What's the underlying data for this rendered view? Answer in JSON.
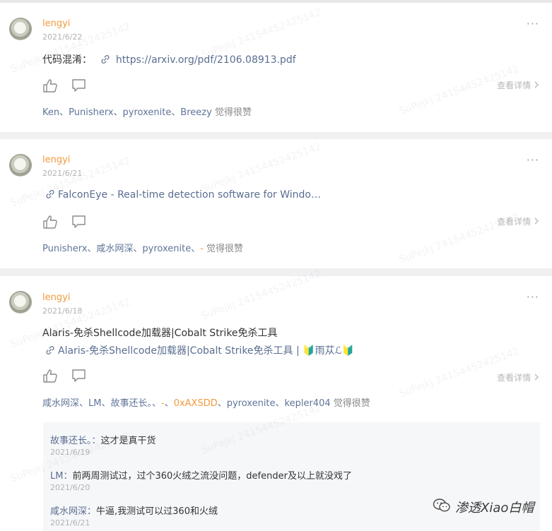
{
  "posts": [
    {
      "author": "lengyi",
      "date": "2021/6/22",
      "title": "代码混淆：",
      "link": "https://arxiv.org/pdf/2106.08913.pdf",
      "detail": "查看详情",
      "likes_names": "Ken、Punisherx、pyroxenite、Breezy",
      "likes_suffix": "觉得很赞"
    },
    {
      "author": "lengyi",
      "date": "2021/6/21",
      "link": "FalconEye - Real-time detection software for Windo…",
      "detail": "查看详情",
      "likes_names": "Punisherx、咸水网深、pyroxenite、",
      "likes_orange": "-",
      "likes_suffix": "觉得很赞"
    },
    {
      "author": "lengyi",
      "date": "2021/6/18",
      "title": "Alaris-免杀Shellcode加载器|Cobalt Strike免杀工具",
      "link": "Alaris-免杀Shellcode加载器|Cobalt Strike免杀工具 | 🔰雨苁ℒ🔰",
      "detail": "查看详情",
      "likes_names_a": "咸水网深、LM、故事还长。、",
      "likes_orange_a": "-",
      "likes_sep": "、",
      "likes_orange_b": "0xAXSDD",
      "likes_names_b": "、pyroxenite、kepler404",
      "likes_suffix": "觉得很赞"
    }
  ],
  "comments": [
    {
      "name": "故事还长。",
      "text": "这才是真干货",
      "date": "2021/6/19"
    },
    {
      "name": "LM",
      "text": "前两周测试过，过个360火绒之流没问题，defender及以上就没戏了",
      "date": "2021/6/20"
    },
    {
      "name": "咸水网深",
      "text": "牛逼,我测试可以过360和火绒",
      "date": "2021/6/21"
    }
  ],
  "brand": {
    "text": "渗透Xiao白帽"
  },
  "more_glyph": "···",
  "comment_sep": "：",
  "watermark_text": "SuPejkj 24154452425142"
}
